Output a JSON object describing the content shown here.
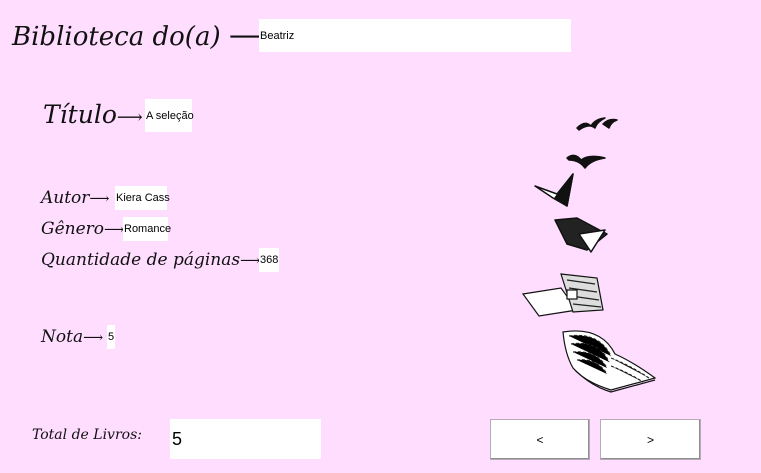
{
  "library": {
    "label": "Biblioteca do(a)",
    "arrow": "⟶",
    "owner": "Beatriz"
  },
  "title": {
    "label": "Título",
    "arrow": "⟶",
    "value": "A seleção"
  },
  "author": {
    "label": "Autor",
    "arrow": "⟶",
    "value": "Kiera Cass"
  },
  "genre": {
    "label": "Gênero",
    "arrow": "⟶",
    "value": "Romance"
  },
  "pages": {
    "label": "Quantidade de páginas",
    "arrow": "⟶",
    "value": "368"
  },
  "rating": {
    "label": "Nota",
    "arrow": "⟶",
    "value": "5"
  },
  "total": {
    "label": "Total de Livros:",
    "value": "5"
  },
  "nav": {
    "prev_label": "<",
    "next_label": ">"
  },
  "illustration": {
    "icon": "flying-books-icon"
  }
}
